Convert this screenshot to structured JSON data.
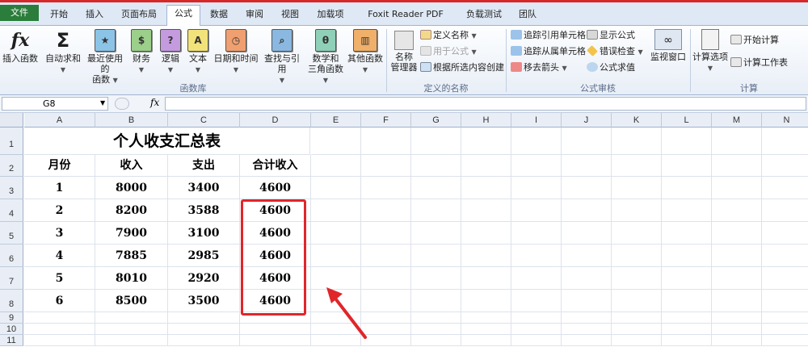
{
  "tabs": [
    "文件",
    "开始",
    "插入",
    "页面布局",
    "公式",
    "数据",
    "审阅",
    "视图",
    "加载项",
    "Foxit Reader PDF",
    "负载测试",
    "团队"
  ],
  "active_tab": "公式",
  "ribbon": {
    "function_library": {
      "label": "函数库",
      "insert_function": "插入函数",
      "autosum": "自动求和",
      "recent_line1": "最近使用的",
      "recent_line2": "函数",
      "financial": "财务",
      "logical": "逻辑",
      "text": "文本",
      "datetime": "日期和时间",
      "lookup": "查找与引用",
      "math_line1": "数学和",
      "math_line2": "三角函数",
      "more": "其他函数"
    },
    "defined_names": {
      "label": "定义的名称",
      "name_manager_line1": "名称",
      "name_manager_line2": "管理器",
      "define_name": "定义名称",
      "use_in_formula": "用于公式",
      "create_from_selection": "根据所选内容创建"
    },
    "formula_auditing": {
      "label": "公式审核",
      "trace_precedents": "追踪引用单元格",
      "trace_dependents": "追踪从属单元格",
      "remove_arrows": "移去箭头",
      "show_formulas": "显示公式",
      "error_checking": "错误检查",
      "evaluate_formula": "公式求值",
      "watch_window": "监视窗口"
    },
    "calculation": {
      "label": "计算",
      "options": "计算选项",
      "calc_now": "开始计算",
      "calc_sheet": "计算工作表"
    }
  },
  "formula_bar": {
    "name_box": "G8",
    "fx": "fx",
    "content": ""
  },
  "columns": [
    "A",
    "B",
    "C",
    "D",
    "E",
    "F",
    "G",
    "H",
    "I",
    "J",
    "K",
    "L",
    "M",
    "N"
  ],
  "rows": [
    "1",
    "2",
    "3",
    "4",
    "5",
    "6",
    "7",
    "8",
    "9",
    "10",
    "11"
  ],
  "sheet": {
    "title": "个人收支汇总表",
    "headers": [
      "月份",
      "收入",
      "支出",
      "合计收入"
    ],
    "data": [
      [
        "1",
        "8000",
        "3400",
        "4600"
      ],
      [
        "2",
        "8200",
        "3588",
        "4600"
      ],
      [
        "3",
        "7900",
        "3100",
        "4600"
      ],
      [
        "4",
        "7885",
        "2985",
        "4600"
      ],
      [
        "5",
        "8010",
        "2920",
        "4600"
      ],
      [
        "6",
        "8500",
        "3500",
        "4600"
      ]
    ]
  },
  "colors": {
    "annotation_red": "#e0262b",
    "file_tab": "#2a7d3a"
  }
}
